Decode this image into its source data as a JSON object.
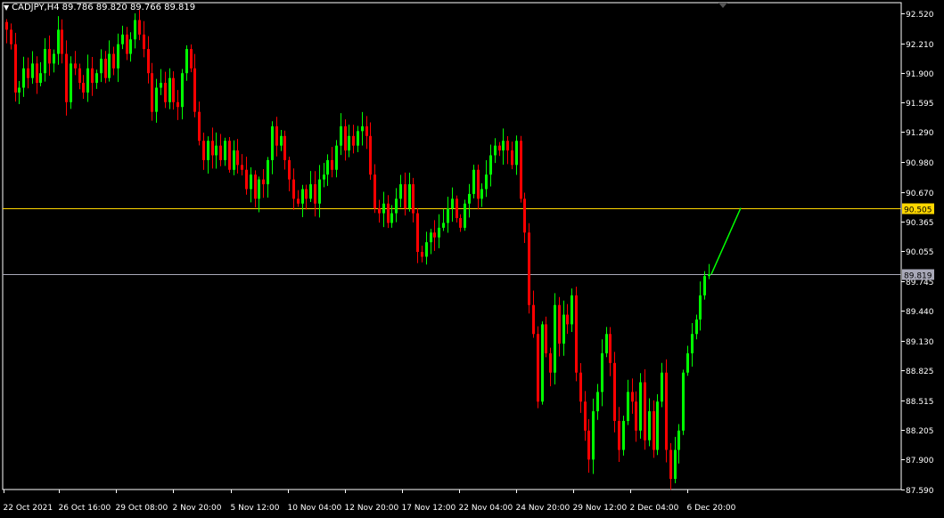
{
  "header": {
    "menu_icon": "down-triangle-icon",
    "symbol": "CADJPY,H4",
    "ohlc": "89.786 89.820 89.766 89.819"
  },
  "colors": {
    "background": "#000000",
    "frame": "#FFFFFF",
    "bull": "#00FF00",
    "bear": "#FF0000",
    "text": "#FFFFFF",
    "level_line": "#FFD700",
    "bid_line": "#A9A9B8"
  },
  "chart_data": {
    "type": "candlestick",
    "symbol": "CADJPY",
    "timeframe": "H4",
    "ylim": [
      87.59,
      92.63
    ],
    "y_ticks": [
      "92.520",
      "92.210",
      "91.900",
      "91.595",
      "91.290",
      "90.980",
      "90.670",
      "90.365",
      "90.055",
      "89.745",
      "89.440",
      "89.130",
      "88.825",
      "88.515",
      "88.205",
      "87.900",
      "87.590"
    ],
    "x_ticks": [
      "22 Oct 2021",
      "26 Oct 16:00",
      "29 Oct 08:00",
      "2 Nov 20:00",
      "5 Nov 12:00",
      "10 Nov 04:00",
      "12 Nov 20:00",
      "17 Nov 12:00",
      "22 Nov 04:00",
      "24 Nov 20:00",
      "29 Nov 12:00",
      "2 Dec 04:00",
      "6 Dec 20:00"
    ],
    "horizontal_levels": [
      {
        "price": 90.505,
        "label": "90.505",
        "color": "#FFD700"
      },
      {
        "price": 89.819,
        "label": "89.819",
        "color": "#A9A9B8"
      }
    ],
    "projection": {
      "from": 89.819,
      "to": 90.505,
      "color": "#00FF00"
    },
    "closes": [
      92.35,
      92.2,
      91.7,
      91.75,
      91.95,
      91.85,
      92.0,
      91.8,
      91.9,
      92.15,
      92.0,
      92.1,
      92.35,
      92.1,
      91.6,
      92.0,
      91.95,
      91.8,
      91.7,
      91.95,
      91.8,
      91.9,
      92.05,
      91.85,
      92.1,
      91.95,
      92.2,
      92.3,
      92.1,
      92.25,
      92.45,
      92.3,
      92.15,
      91.9,
      91.5,
      91.75,
      91.8,
      91.6,
      91.85,
      91.6,
      91.55,
      91.9,
      92.15,
      91.95,
      91.5,
      91.2,
      91.0,
      91.2,
      91.05,
      91.15,
      91.0,
      91.2,
      90.9,
      91.1,
      90.95,
      90.9,
      90.7,
      90.85,
      90.6,
      90.8,
      90.75,
      91.0,
      91.35,
      91.15,
      91.25,
      91.0,
      90.8,
      90.6,
      90.55,
      90.7,
      90.6,
      90.75,
      90.55,
      90.8,
      90.85,
      91.0,
      90.9,
      91.15,
      91.35,
      91.1,
      91.25,
      91.15,
      91.3,
      91.35,
      91.25,
      90.85,
      90.5,
      90.45,
      90.55,
      90.35,
      90.45,
      90.6,
      90.75,
      90.5,
      90.75,
      90.45,
      90.05,
      90.0,
      90.15,
      90.25,
      90.2,
      90.3,
      90.35,
      90.5,
      90.6,
      90.4,
      90.3,
      90.55,
      90.65,
      90.9,
      90.6,
      90.7,
      90.85,
      91.05,
      91.15,
      91.1,
      91.2,
      91.1,
      90.95,
      91.2,
      90.6,
      90.25,
      89.5,
      89.2,
      88.5,
      89.3,
      89.0,
      88.8,
      89.5,
      89.1,
      89.4,
      89.3,
      89.6,
      88.8,
      88.5,
      88.2,
      87.9,
      88.4,
      88.6,
      89.0,
      89.2,
      88.9,
      88.3,
      88.0,
      88.3,
      88.6,
      88.5,
      88.2,
      88.7,
      88.1,
      88.4,
      88.0,
      88.5,
      88.8,
      88.0,
      87.7,
      88.0,
      88.2,
      88.8,
      89.0,
      89.2,
      89.35,
      89.6,
      89.8,
      89.819
    ]
  }
}
